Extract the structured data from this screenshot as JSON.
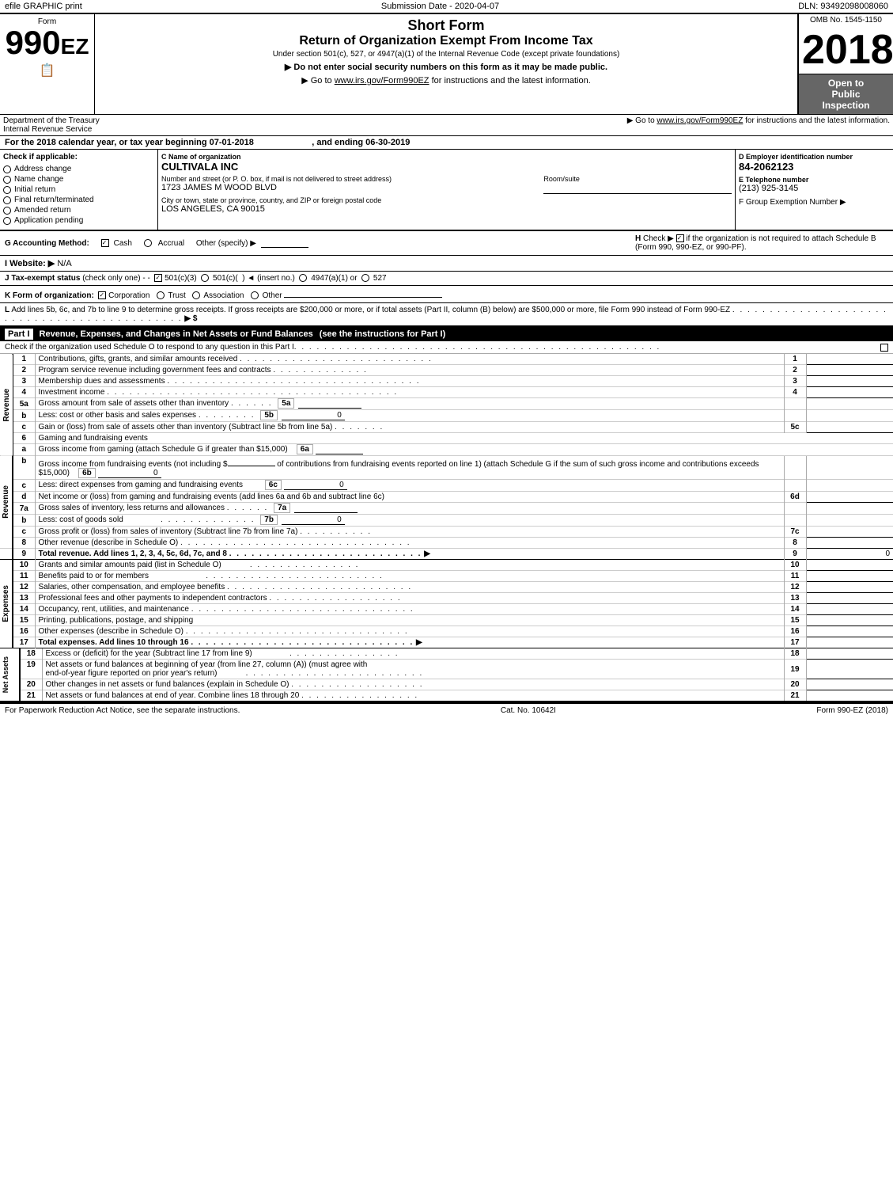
{
  "topBar": {
    "left": "efile GRAPHIC print",
    "center": "Submission Date - 2020-04-07",
    "right": "DLN: 93492098008060"
  },
  "form": {
    "label": "Form",
    "number": "990",
    "ez": "EZ",
    "ombNo": "OMB No. 1545-1150",
    "year": "2018",
    "shortFormTitle": "Short Form",
    "returnTitle": "Return of Organization Exempt From Income Tax",
    "underSection": "Under section 501(c), 527, or 4947(a)(1) of the Internal Revenue Code (except private foundations)",
    "ssnNotice": "Do not enter social security numbers on this form as it may be made public.",
    "irsLink": "Go to www.irs.gov/Form990EZ for instructions and the latest information.",
    "openToPublic": "Open to\nPublic\nInspection"
  },
  "dept": {
    "text": "Department of the Treasury\nInternal Revenue Service"
  },
  "calendarYear": {
    "text": "For the 2018 calendar year, or tax year beginning 07-01-2018",
    "ending": ", and ending 06-30-2019"
  },
  "checkApplicable": {
    "label": "Check if applicable:",
    "items": [
      "Address change",
      "Name change",
      "Initial return",
      "Final return/terminated",
      "Amended return",
      "Application pending"
    ]
  },
  "org": {
    "cLabel": "C Name of organization",
    "name": "CULTIVALA INC",
    "streetLabel": "Number and street (or P. O. box, if mail is not delivered to street address)",
    "street": "1723 JAMES M WOOD BLVD",
    "roomLabel": "Room/suite",
    "roomValue": "",
    "cityLabel": "City or town, state or province, country, and ZIP or foreign postal code",
    "city": "LOS ANGELES, CA  90015"
  },
  "ein": {
    "dLabel": "D Employer identification number",
    "value": "84-2062123",
    "eLabel": "E Telephone number",
    "phone": "(213) 925-3145",
    "fLabel": "F Group Exemption Number",
    "fArrow": "▶"
  },
  "accounting": {
    "gLabel": "G Accounting Method:",
    "cash": "Cash",
    "accrual": "Accrual",
    "other": "Other (specify) ▶",
    "hLabel": "H Check ▶",
    "hCheckbox": "if the organization is not required to attach Schedule B (Form 990, 990-EZ, or 990-PF)."
  },
  "website": {
    "iLabel": "I Website: ▶",
    "value": "N/A"
  },
  "taxStatus": {
    "jLabel": "J Tax-exempt status",
    "checkOnly": "(check only one) -",
    "options": [
      "501(c)(3)",
      "501(c)(",
      ")◄ (insert no.)",
      "4947(a)(1) or",
      "527"
    ]
  },
  "formOrg": {
    "kLabel": "K Form of organization:",
    "options": [
      "Corporation",
      "Trust",
      "Association",
      "Other"
    ],
    "selected": "Corporation"
  },
  "lSection": {
    "text": "L Add lines 5b, 6c, and 7b to line 9 to determine gross receipts. If gross receipts are $200,000 or more, or if total assets (Part II, column (B) below) are $500,000 or more, file Form 990 instead of Form 990-EZ",
    "dots": ".",
    "arrow": "▶ $"
  },
  "partI": {
    "label": "Part I",
    "title": "Revenue, Expenses, and Changes in Net Assets or Fund Balances",
    "seeInstructions": "(see the instructions for Part I)",
    "scheduleOCheck": "Check if the organization used Schedule O to respond to any question in this Part I",
    "dots": ".",
    "checkBox": "O"
  },
  "revenueRows": [
    {
      "num": "1",
      "desc": "Contributions, gifts, grants, and similar amounts received",
      "dots": true,
      "value": ""
    },
    {
      "num": "2",
      "desc": "Program service revenue including government fees and contracts",
      "dots": true,
      "value": ""
    },
    {
      "num": "3",
      "desc": "Membership dues and assessments",
      "dots": true,
      "value": ""
    },
    {
      "num": "4",
      "desc": "Investment income",
      "dots": true,
      "value": ""
    },
    {
      "num": "5a",
      "desc": "Gross amount from sale of assets other than inventory",
      "dots": true,
      "subNum": "5a",
      "subValue": ""
    },
    {
      "num": "b",
      "desc": "Less: cost or other basis and sales expenses",
      "dots": true,
      "subNum": "5b",
      "subValue": "0"
    },
    {
      "num": "c",
      "desc": "Gain or (loss) from sale of assets other than inventory (Subtract line 5b from line 5a)",
      "dots": true,
      "mainNum": "5c",
      "value": ""
    },
    {
      "num": "6",
      "desc": "Gaming and fundraising events",
      "dots": false,
      "value": ""
    },
    {
      "num": "a",
      "desc": "Gross income from gaming (attach Schedule G if greater than $15,000)",
      "subNum": "6a",
      "subValue": ""
    },
    {
      "num": "b",
      "desc": "Gross income from fundraising events (not including $ _______________ of contributions from fundraising events reported on line 1) (attach Schedule G if the sum of such gross income and contributions exceeds $15,000)",
      "subNum": "6b",
      "subValue": "0"
    },
    {
      "num": "c",
      "desc": "Less: direct expenses from gaming and fundraising events",
      "subNum": "6c",
      "subValue": "0"
    },
    {
      "num": "d",
      "desc": "Net income or (loss) from gaming and fundraising events (add lines 6a and 6b and subtract line 6c)",
      "mainNum": "6d",
      "value": ""
    },
    {
      "num": "7a",
      "desc": "Gross sales of inventory, less returns and allowances",
      "dots": true,
      "subNum": "7a",
      "subValue": ""
    },
    {
      "num": "b",
      "desc": "Less: cost of goods sold",
      "dots": true,
      "subNum": "7b",
      "subValue": "0"
    },
    {
      "num": "c",
      "desc": "Gross profit or (loss) from sales of inventory (Subtract line 7b from line 7a)",
      "dots": true,
      "mainNum": "7c",
      "value": ""
    },
    {
      "num": "8",
      "desc": "Other revenue (describe in Schedule O)",
      "dots": true,
      "mainNum": "8",
      "value": ""
    },
    {
      "num": "9",
      "desc": "Total revenue. Add lines 1, 2, 3, 4, 5c, 6d, 7c, and 8",
      "dots": true,
      "bold": true,
      "mainNum": "9",
      "value": "0",
      "arrow": true
    }
  ],
  "expenseRows": [
    {
      "num": "10",
      "desc": "Grants and similar amounts paid (list in Schedule O)",
      "dots": true,
      "value": ""
    },
    {
      "num": "11",
      "desc": "Benefits paid to or for members",
      "dots": true,
      "value": ""
    },
    {
      "num": "12",
      "desc": "Salaries, other compensation, and employee benefits",
      "dots": true,
      "value": ""
    },
    {
      "num": "13",
      "desc": "Professional fees and other payments to independent contractors",
      "dots": true,
      "value": ""
    },
    {
      "num": "14",
      "desc": "Occupancy, rent, utilities, and maintenance",
      "dots": true,
      "value": ""
    },
    {
      "num": "15",
      "desc": "Printing, publications, postage, and shipping",
      "dots": false,
      "value": ""
    },
    {
      "num": "16",
      "desc": "Other expenses (describe in Schedule O)",
      "dots": true,
      "value": ""
    },
    {
      "num": "17",
      "desc": "Total expenses. Add lines 10 through 16",
      "dots": true,
      "bold": true,
      "value": "",
      "arrow": true
    }
  ],
  "netAssetRows": [
    {
      "num": "18",
      "desc": "Excess or (deficit) for the year (Subtract line 17 from line 9)",
      "dots": true,
      "value": ""
    },
    {
      "num": "19",
      "desc": "Net assets or fund balances at beginning of year (from line 27, column (A)) (must agree with end-of-year figure reported on prior year's return)",
      "dots": true,
      "value": ""
    },
    {
      "num": "20",
      "desc": "Other changes in net assets or fund balances (explain in Schedule O)",
      "dots": true,
      "value": ""
    },
    {
      "num": "21",
      "desc": "Net assets or fund balances at end of year. Combine lines 18 through 20",
      "dots": true,
      "value": ""
    }
  ],
  "footer": {
    "left": "For Paperwork Reduction Act Notice, see the separate instructions.",
    "center": "Cat. No. 10642I",
    "right": "Form 990-EZ (2018)"
  },
  "sideLabels": {
    "revenue": "Revenue",
    "expenses": "Expenses",
    "netAssets": "Net Assets"
  }
}
